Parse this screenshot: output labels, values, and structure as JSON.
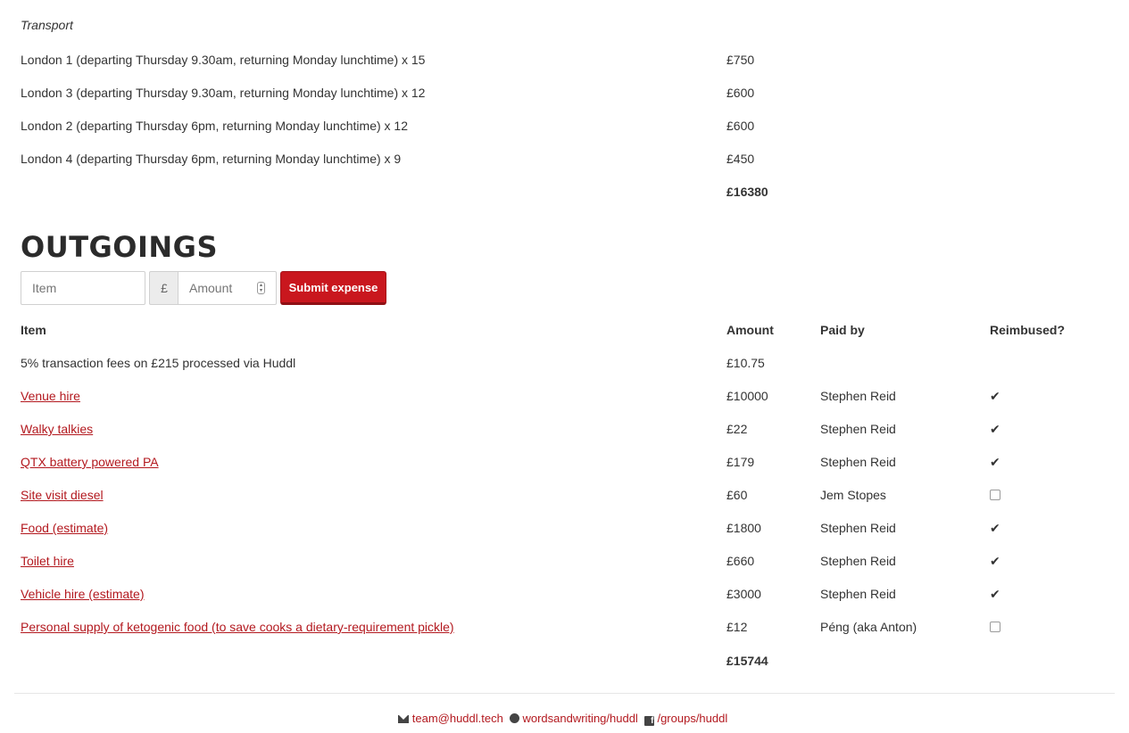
{
  "transport": {
    "label": "Transport",
    "rows": [
      {
        "item": "London 1 (departing Thursday 9.30am, returning Monday lunchtime) x 15",
        "amount": "£750"
      },
      {
        "item": "London 3 (departing Thursday 9.30am, returning Monday lunchtime) x 12",
        "amount": "£600"
      },
      {
        "item": "London 2 (departing Thursday 6pm, returning Monday lunchtime) x 12",
        "amount": "£600"
      },
      {
        "item": "London 4 (departing Thursday 6pm, returning Monday lunchtime) x 9",
        "amount": "£450"
      }
    ],
    "total": "£16380"
  },
  "outgoings": {
    "heading": "OUTGOINGS",
    "form": {
      "item_placeholder": "Item",
      "currency": "£",
      "amount_placeholder": "Amount",
      "submit_label": "Submit expense"
    },
    "headers": {
      "item": "Item",
      "amount": "Amount",
      "paid_by": "Paid by",
      "reimbursed": "Reimbused?"
    },
    "fee_row": {
      "item": "5% transaction fees on £215 processed via Huddl",
      "amount": "£10.75"
    },
    "rows": [
      {
        "item": "Venue hire",
        "amount": "£10000",
        "paid_by": "Stephen Reid",
        "reimbursed": true
      },
      {
        "item": "Walky talkies",
        "amount": "£22",
        "paid_by": "Stephen Reid",
        "reimbursed": true
      },
      {
        "item": "QTX battery powered PA",
        "amount": "£179",
        "paid_by": "Stephen Reid",
        "reimbursed": true
      },
      {
        "item": "Site visit diesel",
        "amount": "£60",
        "paid_by": "Jem Stopes",
        "reimbursed": false
      },
      {
        "item": "Food (estimate)",
        "amount": "£1800",
        "paid_by": "Stephen Reid",
        "reimbursed": true
      },
      {
        "item": "Toilet hire",
        "amount": "£660",
        "paid_by": "Stephen Reid",
        "reimbursed": true
      },
      {
        "item": "Vehicle hire (estimate)",
        "amount": "£3000",
        "paid_by": "Stephen Reid",
        "reimbursed": true
      },
      {
        "item": "Personal supply of ketogenic food (to save cooks a dietary-requirement pickle)",
        "amount": "£12",
        "paid_by": "Péng (aka Anton)",
        "reimbursed": false
      }
    ],
    "total": "£15744"
  },
  "footer": {
    "email": "team@huddl.tech",
    "github": "wordsandwriting/huddl",
    "facebook": "/groups/huddl",
    "icons": [
      "envelope-icon",
      "github-icon",
      "facebook-icon"
    ]
  },
  "colors": {
    "accent": "#c9171e",
    "link": "#b3191f",
    "text": "#333333"
  }
}
